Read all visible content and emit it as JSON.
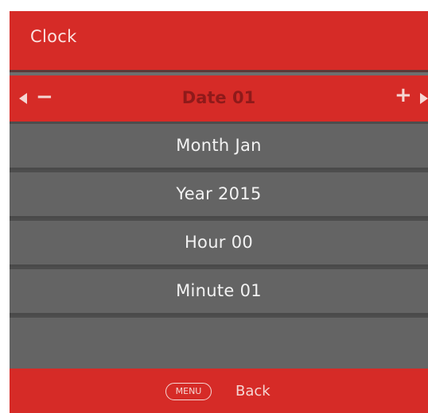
{
  "header": {
    "title": "Clock"
  },
  "selected": {
    "label": "Date 01",
    "decrement_icon": "left-arrow-icon",
    "decrement_label": "−",
    "increment_label": "+",
    "increment_icon": "right-arrow-icon"
  },
  "menu": {
    "items": [
      {
        "label": "Month Jan"
      },
      {
        "label": "Year 2015"
      },
      {
        "label": "Hour 00"
      },
      {
        "label": "Minute 01"
      },
      {
        "label": ""
      }
    ]
  },
  "footer": {
    "menu_key": "MENU",
    "back_label": "Back"
  },
  "colors": {
    "accent_red": "#d62b27",
    "row_gray": "#646464",
    "selected_text": "#8f1a1a"
  }
}
